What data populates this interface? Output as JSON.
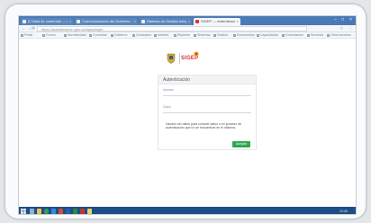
{
  "browser": {
    "tabs": [
      {
        "title": "A Tabla de contenido — Gobierno",
        "active": false
      },
      {
        "title": "Comunicaciones del Gobierno",
        "active": false
      },
      {
        "title": "Sistema de Gestión Integral",
        "active": false
      },
      {
        "title": "SIGEP — Autenticación",
        "active": true
      }
    ],
    "window_controls": [
      "–",
      "□",
      "×"
    ],
    "nav": {
      "back": "←",
      "forward": "→",
      "reload": "⟳"
    },
    "url": "https://autenticacion.gov.co/sigep/login",
    "tool_icons": [
      "☆",
      "⋮"
    ],
    "bookmarks": [
      "Portal",
      "Correo",
      "Normatividad",
      "Consultas",
      "Gobierno",
      "Ciudadano",
      "Intranet",
      "Reportes",
      "Sistemas",
      "Gestión",
      "Documentos",
      "Capacitación",
      "Contratación",
      "Servicios",
      "Otros favoritos"
    ]
  },
  "page": {
    "logo_text": "SIGEP",
    "brand_colors": {
      "logo_red": "#d9322e",
      "logo_orange": "#f39a1e",
      "crest_gold": "#d6a531"
    },
    "card": {
      "title": "Autenticación",
      "user_label": "Usuario",
      "password_label": "Clave",
      "message": "Usuario sin datos para conocer datos o en proceso de autenticación que no se encuentran en el sistema.",
      "button_label": "Aceptar",
      "button_color": "#2fa84f"
    }
  },
  "taskbar": {
    "color": "#1d4f86",
    "icons": [
      "start-icon",
      "search-icon",
      "explorer-icon",
      "chrome-icon",
      "ie-icon",
      "outlook-icon",
      "word-icon",
      "excel-icon",
      "pdf-icon",
      "photos-icon"
    ],
    "tray_time": "10:45"
  }
}
